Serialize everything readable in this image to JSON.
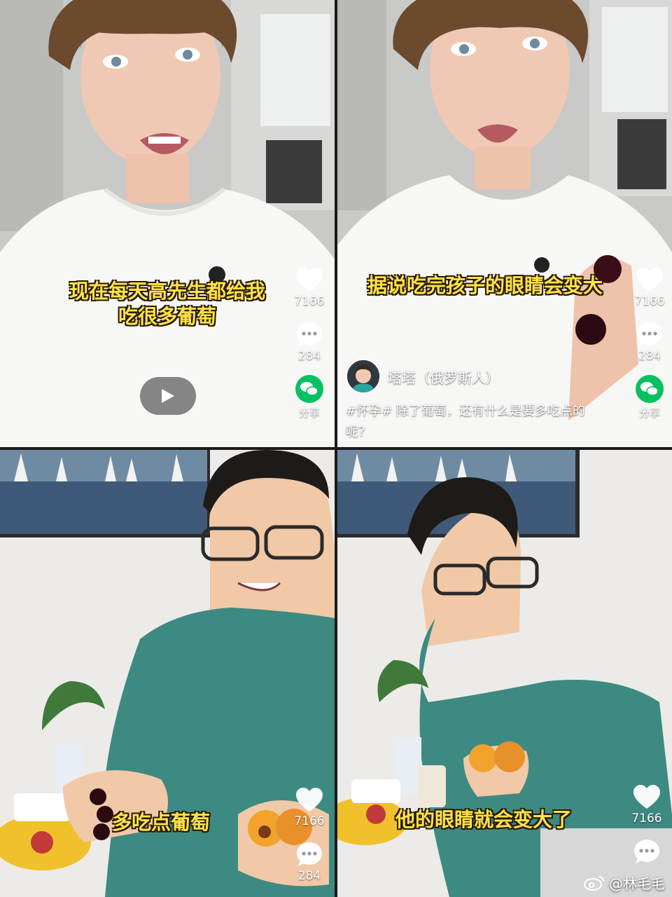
{
  "panels": [
    {
      "caption_lines": [
        "现在每天高先生都给我",
        "吃很多葡萄"
      ],
      "likes": "7166",
      "comments": "284",
      "share_label": "分享"
    },
    {
      "caption_lines": [
        "据说吃完孩子的眼睛会变大"
      ],
      "likes": "7166",
      "comments": "284",
      "share_label": "分享",
      "author": "塔塔（俄罗斯人）",
      "description": "#怀孕# 除了葡萄，还有什么是要多吃点的呢？"
    },
    {
      "caption_lines": [
        "多吃点葡萄"
      ],
      "likes": "7166",
      "comments": "284"
    },
    {
      "caption_lines": [
        "他的眼睛就会变大了"
      ],
      "likes": "7166"
    }
  ],
  "watermark": "@林毛毛",
  "colors": {
    "caption": "#ffe34a",
    "wechat": "#07c160"
  },
  "icons": [
    "heart-icon",
    "comment-icon",
    "wechat-icon",
    "play-icon",
    "weibo-icon"
  ]
}
